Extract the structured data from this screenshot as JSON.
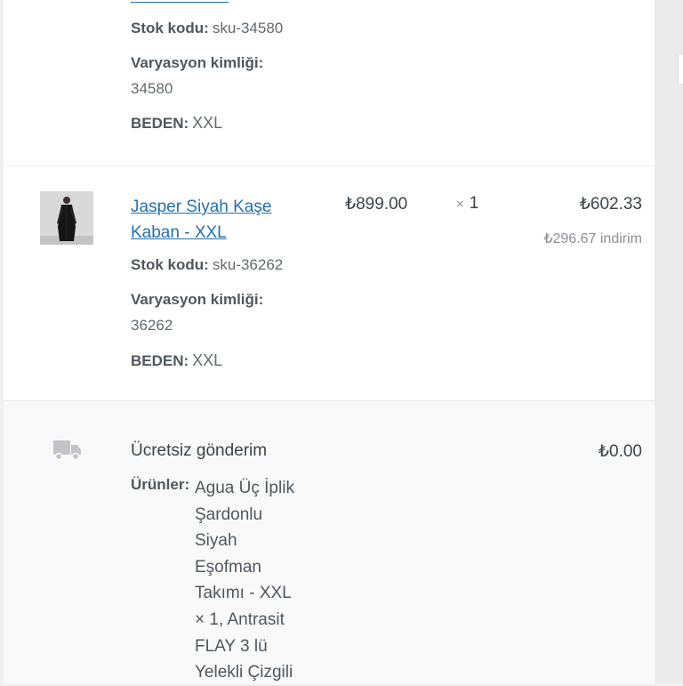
{
  "items": [
    {
      "sku_label": "Stok kodu:",
      "sku": "sku-34580",
      "variation_label": "Varyasyon kimliği:",
      "variation_id": "34580",
      "size_label": "BEDEN:",
      "size": "XXL"
    },
    {
      "name": "Jasper Siyah Kaşe Kaban - XXL",
      "price": "₺899.00",
      "qty_symbol": "×",
      "qty": "1",
      "total": "₺602.33",
      "discount": "₺296.67 indirim",
      "sku_label": "Stok kodu:",
      "sku": "sku-36262",
      "variation_label": "Varyasyon kimliği:",
      "variation_id": "36262",
      "size_label": "BEDEN:",
      "size": "XXL"
    }
  ],
  "shipping": {
    "icon": "truck-icon",
    "title": "Ücretsiz gönderim",
    "cost": "₺0.00",
    "products_label": "Ürünler:",
    "products": "Agua Üç İplik Şardonlu Siyah Eşofman Takımı - XXL × 1, Antrasit FLAY 3 lü Yelekli Çizgili"
  }
}
